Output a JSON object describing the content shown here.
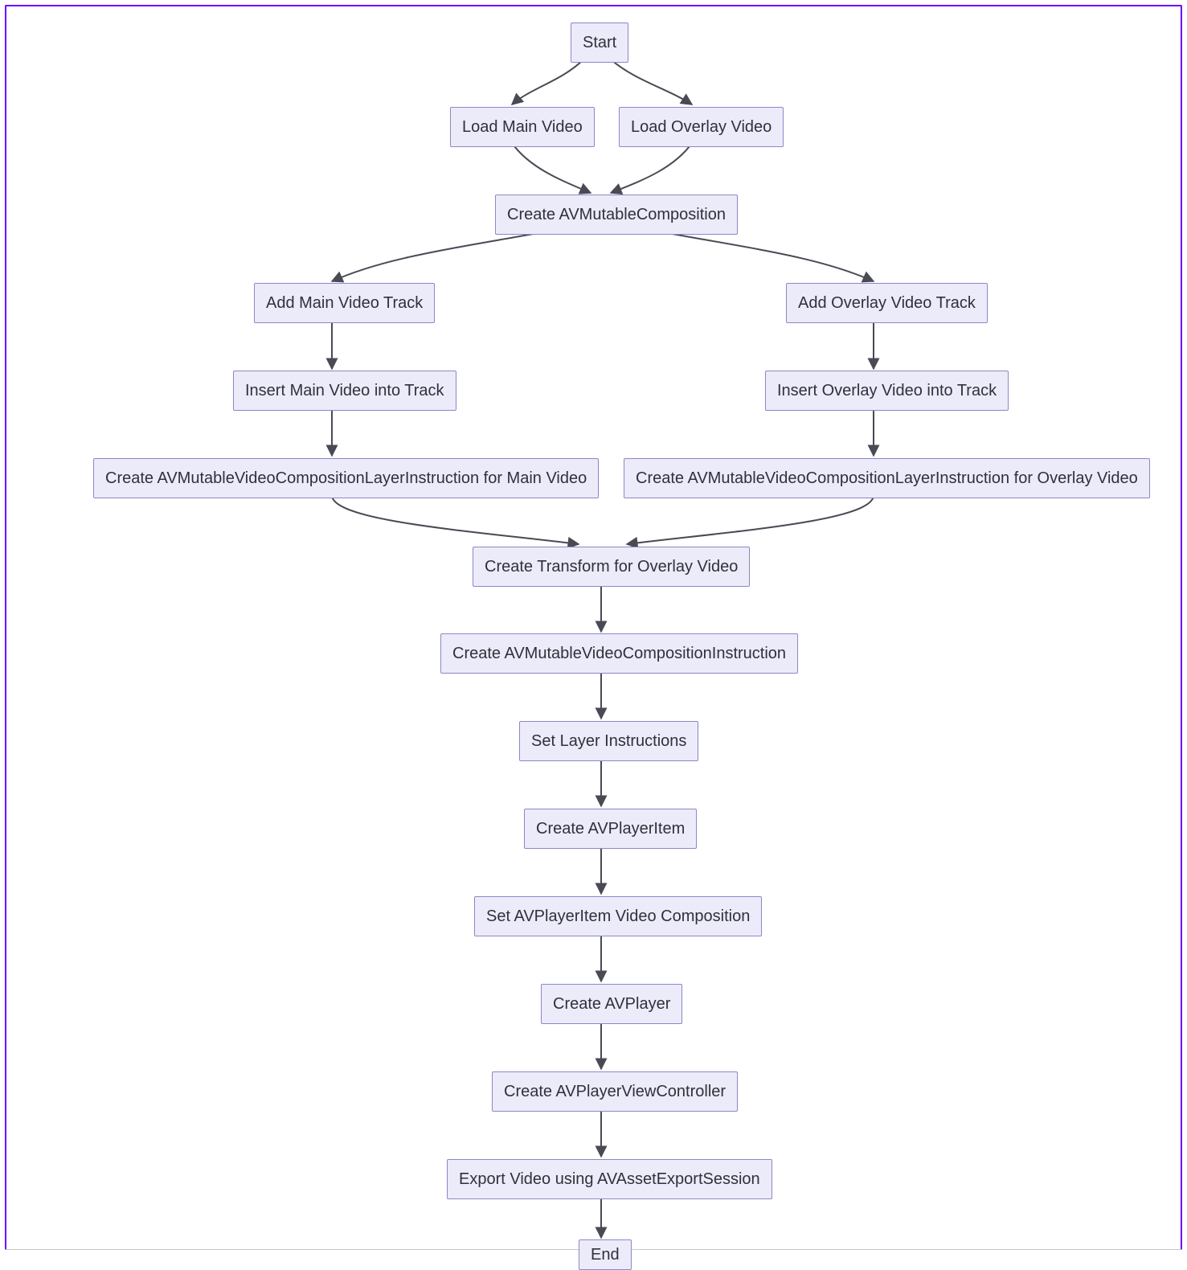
{
  "chart_data": {
    "type": "flowchart",
    "direction": "TD",
    "nodes": [
      {
        "id": "A",
        "label": "Start"
      },
      {
        "id": "B",
        "label": "Load Main Video"
      },
      {
        "id": "C",
        "label": "Load Overlay Video"
      },
      {
        "id": "D",
        "label": "Create AVMutableComposition"
      },
      {
        "id": "E",
        "label": "Add Main Video Track"
      },
      {
        "id": "L",
        "label": "Add Overlay Video Track"
      },
      {
        "id": "F",
        "label": "Insert Main Video into Track"
      },
      {
        "id": "M",
        "label": "Insert Overlay Video into Track"
      },
      {
        "id": "G",
        "label": "Create AVMutableVideoCompositionLayerInstruction for Main Video"
      },
      {
        "id": "N",
        "label": "Create AVMutableVideoCompositionLayerInstruction for Overlay Video"
      },
      {
        "id": "H",
        "label": "Create Transform for Overlay Video"
      },
      {
        "id": "I",
        "label": "Create AVMutableVideoCompositionInstruction"
      },
      {
        "id": "J",
        "label": "Set Layer Instructions"
      },
      {
        "id": "K",
        "label": "Create AVPlayerItem"
      },
      {
        "id": "O",
        "label": "Set AVPlayerItem Video Composition"
      },
      {
        "id": "P",
        "label": "Create AVPlayer"
      },
      {
        "id": "Q",
        "label": "Create AVPlayerViewController"
      },
      {
        "id": "R",
        "label": "Export Video using AVAssetExportSession"
      },
      {
        "id": "S",
        "label": "End"
      }
    ],
    "edges": [
      [
        "A",
        "B"
      ],
      [
        "A",
        "C"
      ],
      [
        "B",
        "D"
      ],
      [
        "C",
        "D"
      ],
      [
        "D",
        "E"
      ],
      [
        "D",
        "L"
      ],
      [
        "E",
        "F"
      ],
      [
        "L",
        "M"
      ],
      [
        "F",
        "G"
      ],
      [
        "M",
        "N"
      ],
      [
        "G",
        "H"
      ],
      [
        "N",
        "H"
      ],
      [
        "H",
        "I"
      ],
      [
        "I",
        "J"
      ],
      [
        "J",
        "K"
      ],
      [
        "K",
        "O"
      ],
      [
        "O",
        "P"
      ],
      [
        "P",
        "Q"
      ],
      [
        "Q",
        "R"
      ],
      [
        "R",
        "S"
      ]
    ]
  },
  "nodes": {
    "A": {
      "label": "Start"
    },
    "B": {
      "label": "Load Main Video"
    },
    "C": {
      "label": "Load Overlay Video"
    },
    "D": {
      "label": "Create AVMutableComposition"
    },
    "E": {
      "label": "Add Main Video Track"
    },
    "L": {
      "label": "Add Overlay Video Track"
    },
    "F": {
      "label": "Insert Main Video into Track"
    },
    "M": {
      "label": "Insert Overlay Video into Track"
    },
    "G": {
      "label": "Create AVMutableVideoCompositionLayerInstruction for Main Video"
    },
    "N": {
      "label": "Create AVMutableVideoCompositionLayerInstruction for Overlay Video"
    },
    "H": {
      "label": "Create Transform for Overlay Video"
    },
    "I": {
      "label": "Create AVMutableVideoCompositionInstruction"
    },
    "J": {
      "label": "Set Layer Instructions"
    },
    "K": {
      "label": "Create AVPlayerItem"
    },
    "O": {
      "label": "Set AVPlayerItem Video Composition"
    },
    "P": {
      "label": "Create AVPlayer"
    },
    "Q": {
      "label": "Create AVPlayerViewController"
    },
    "R": {
      "label": "Export Video using AVAssetExportSession"
    },
    "S": {
      "label": "End"
    }
  },
  "colors": {
    "node_fill": "#ecebfa",
    "node_border": "#8e86c8",
    "edge": "#4a4a55",
    "frame": "#6a00ff"
  }
}
